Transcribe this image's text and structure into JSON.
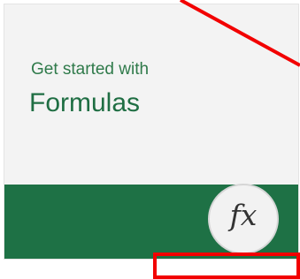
{
  "tile": {
    "subtitle": "Get started with",
    "title": "Formulas",
    "icon": "fx-icon",
    "icon_text": "fx",
    "colors": {
      "band": "#1e7145",
      "text": "#1f6e43",
      "overlay": "#f20000"
    }
  }
}
